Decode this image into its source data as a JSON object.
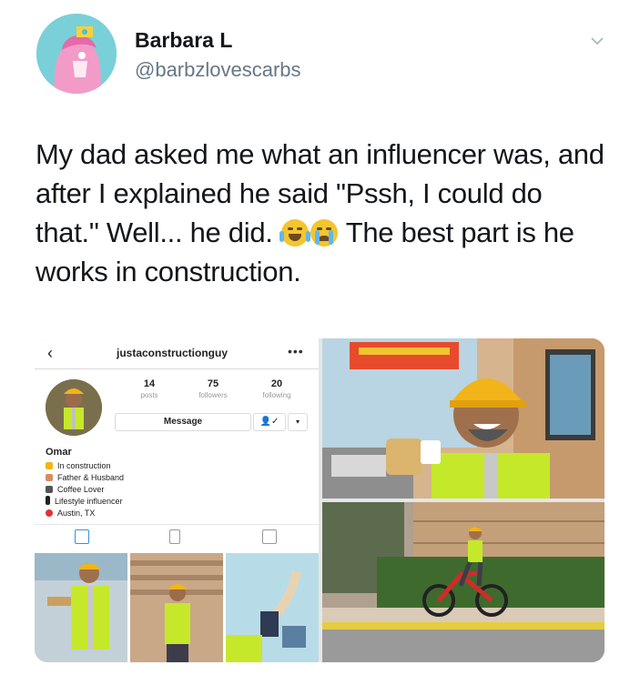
{
  "tweet": {
    "author_name": "Barbara L",
    "author_handle": "@barbzlovescarbs",
    "text_before_emoji": "My dad asked me what an influencer was, and after I explained he said \"Pssh, I could do that.\" Well... he did.",
    "text_after_emoji": "The best part is he works in construction.",
    "emojis": [
      "laughing-crying-emoji",
      "crying-emoji"
    ]
  },
  "instagram_profile": {
    "username": "justaconstructionguy",
    "posts_count": "14",
    "posts_label": "posts",
    "followers_count": "75",
    "followers_label": "followers",
    "following_count": "20",
    "following_label": "following",
    "message_button": "Message",
    "follow_symbol": "👤✓",
    "dropdown_symbol": "▾",
    "display_name": "Omar",
    "bio": [
      {
        "icon": "construction-worker-icon",
        "text": "In construction"
      },
      {
        "icon": "family-icon",
        "text": "Father & Husband"
      },
      {
        "icon": "coffee-icon",
        "text": "Coffee Lover"
      },
      {
        "icon": "phone-icon",
        "text": "Lifestyle influencer"
      },
      {
        "icon": "pin-icon",
        "text": "Austin, TX"
      }
    ]
  },
  "colors": {
    "text_primary": "#14171a",
    "text_secondary": "#657786",
    "avatar_bg": "#7ad0d8",
    "safety_vest": "#c6e82a",
    "hard_hat": "#f2b418"
  }
}
